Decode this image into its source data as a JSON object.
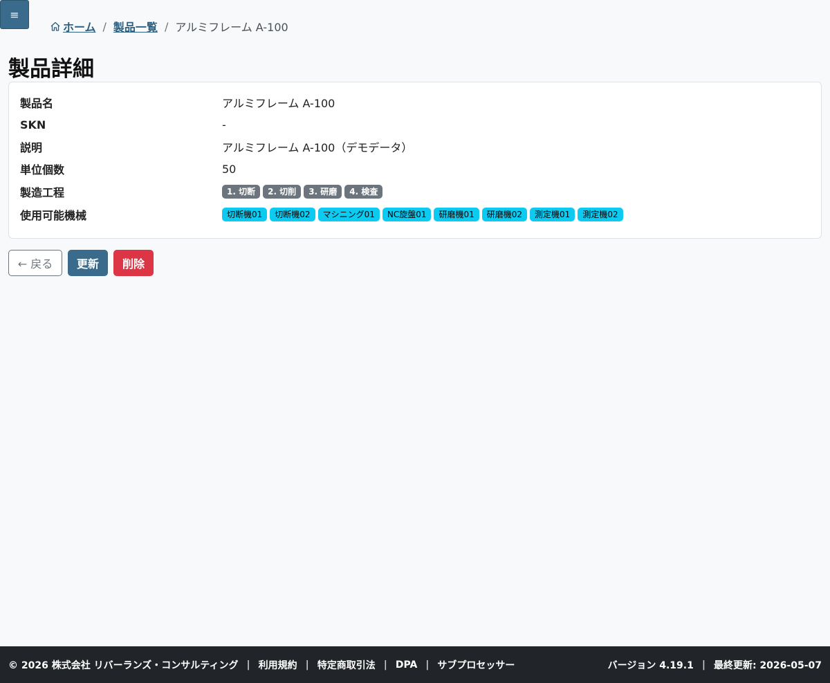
{
  "menu": {
    "icon": "≡"
  },
  "breadcrumb": {
    "home": "ホーム",
    "list": "製品一覧",
    "current": "アルミフレーム A-100",
    "separator": "/"
  },
  "page": {
    "title": "製品詳細"
  },
  "details": {
    "name": {
      "label": "製品名",
      "value": "アルミフレーム A-100"
    },
    "skn": {
      "label": "SKN",
      "value": "-"
    },
    "description": {
      "label": "説明",
      "value": "アルミフレーム A-100（デモデータ）"
    },
    "unit_count": {
      "label": "単位個数",
      "value": "50"
    },
    "process": {
      "label": "製造工程",
      "steps": [
        "1. 切断",
        "2. 切削",
        "3. 研磨",
        "4. 検査"
      ]
    },
    "machines": {
      "label": "使用可能機械",
      "items": [
        "切断機01",
        "切断機02",
        "マシニング01",
        "NC旋盤01",
        "研磨機01",
        "研磨機02",
        "測定機01",
        "測定機02"
      ]
    }
  },
  "actions": {
    "back": "← 戻る",
    "update": "更新",
    "delete": "削除"
  },
  "footer": {
    "copyright": "© 2026 株式会社 リバーランズ・コンサルティング",
    "links": [
      "利用規約",
      "特定商取引法",
      "DPA",
      "サブプロセッサー"
    ],
    "version": "バージョン 4.19.1",
    "updated": "最終更新: 2026-05-07",
    "separator": "|"
  },
  "colors": {
    "primary": "#3a6b8c",
    "danger": "#dc3545",
    "info": "#0dcaf0",
    "secondary": "#6c757d",
    "footer_bg": "#212529"
  }
}
